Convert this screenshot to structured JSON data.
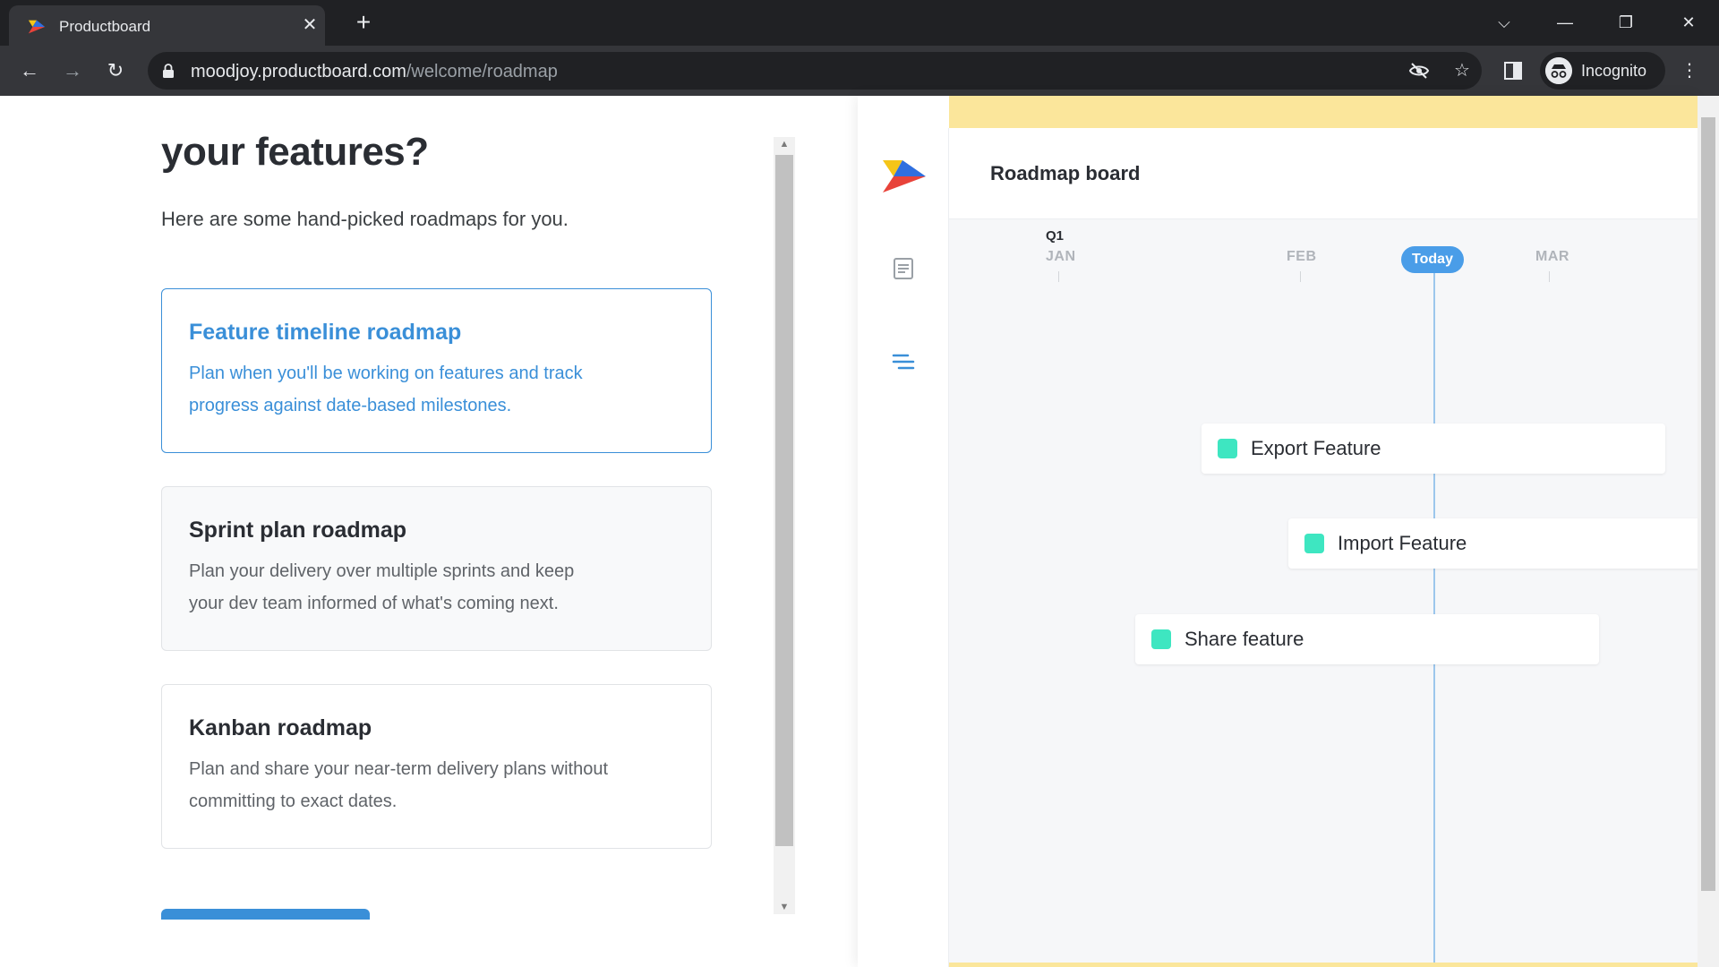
{
  "browser": {
    "tab_title": "Productboard",
    "url_domain": "moodjoy.productboard.com",
    "url_path": "/welcome/roadmap",
    "profile_label": "Incognito"
  },
  "left": {
    "heading": "your features?",
    "subheading": "Here are some hand-picked roadmaps for you.",
    "cards": [
      {
        "title": "Feature timeline roadmap",
        "desc": "Plan when you'll be working on features and track progress against date-based milestones.",
        "state": "selected"
      },
      {
        "title": "Sprint plan roadmap",
        "desc": "Plan your delivery over multiple sprints and keep your dev team informed of what's coming next.",
        "state": "hovered"
      },
      {
        "title": "Kanban roadmap",
        "desc": "Plan and share your near-term delivery plans without committing to exact dates.",
        "state": "default"
      }
    ]
  },
  "preview": {
    "board_title": "Roadmap board",
    "quarter": "Q1",
    "months": [
      "JAN",
      "FEB",
      "MAR"
    ],
    "today_label": "Today",
    "features": [
      "Export Feature",
      "Import Feature",
      "Share feature"
    ]
  },
  "colors": {
    "accent": "#3a8fd8",
    "today": "#4a9de8",
    "feature_status": "#3ee6c1",
    "banner": "#fbe69b"
  },
  "icons": {
    "favicon": "productboard-logo-icon",
    "lock": "lock-icon",
    "eye_off": "eye-off-icon",
    "star": "star-icon",
    "sidepanel": "sidepanel-icon",
    "incognito": "incognito-icon",
    "menu": "kebab-menu-icon"
  }
}
